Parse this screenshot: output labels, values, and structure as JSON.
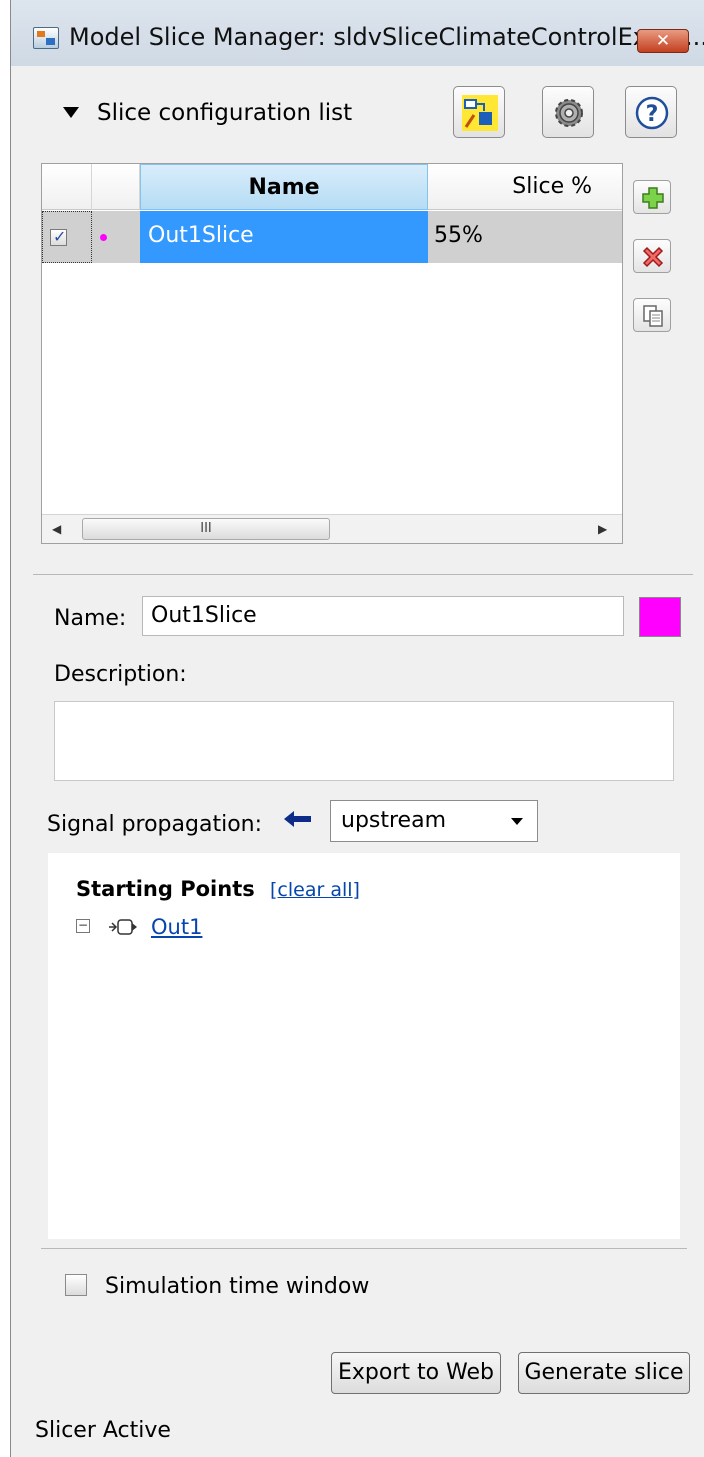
{
  "window": {
    "title": "Model Slice Manager: sldvSliceClimateControlExam...",
    "close_label": "✕"
  },
  "config_section": {
    "title": "Slice configuration list",
    "toolbar": [
      "slice-highlight-icon",
      "gear-icon",
      "help-icon"
    ]
  },
  "table": {
    "columns": [
      "",
      "",
      "Name",
      "Slice %"
    ],
    "rows": [
      {
        "checked": true,
        "color": "#ff00ff",
        "name": "Out1Slice",
        "slice_pct": "55%"
      }
    ],
    "scroll_thumb": "III"
  },
  "side_buttons": [
    "add-icon",
    "delete-icon",
    "copy-icon"
  ],
  "form": {
    "name_label": "Name:",
    "name_value": "Out1Slice",
    "color_swatch": "#ff00ff",
    "description_label": "Description:",
    "description_value": "",
    "signal_label": "Signal propagation:",
    "signal_value": "upstream"
  },
  "starting_points": {
    "title": "Starting Points",
    "clear_all": "[clear all]",
    "items": [
      {
        "label": "Out1"
      }
    ]
  },
  "simulation": {
    "label": "Simulation time window",
    "checked": false
  },
  "buttons": {
    "export": "Export to Web",
    "generate": "Generate slice"
  },
  "status": "Slicer Active"
}
